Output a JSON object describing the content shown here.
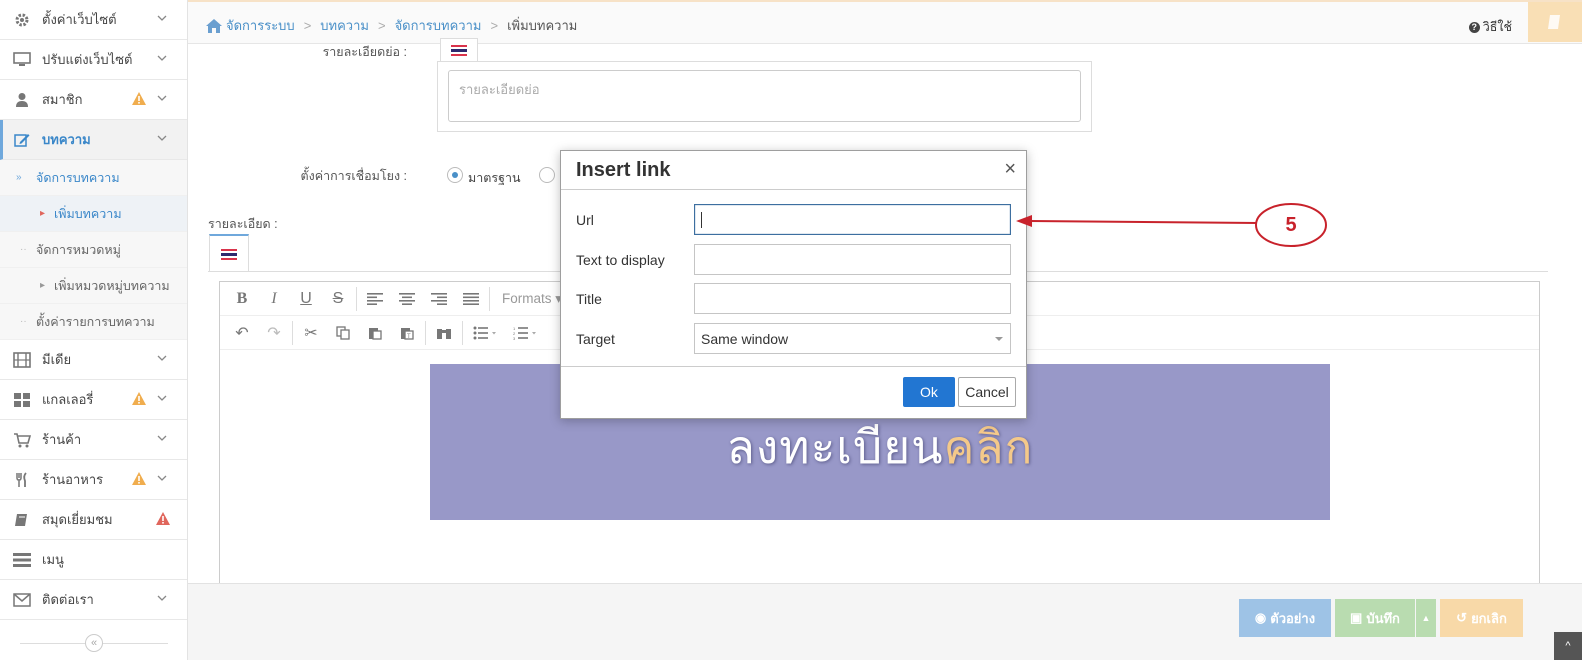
{
  "sidebar": {
    "items": [
      {
        "label": "ตั้งค่าเว็บไซต์",
        "icon": "gear-icon"
      },
      {
        "label": "ปรับแต่งเว็บไซต์",
        "icon": "monitor-icon"
      },
      {
        "label": "สมาชิก",
        "icon": "user-icon"
      },
      {
        "label": "บทความ",
        "icon": "edit-icon"
      },
      {
        "label": "มีเดีย",
        "icon": "film-icon"
      },
      {
        "label": "แกลเลอรี่",
        "icon": "grid-icon"
      },
      {
        "label": "ร้านค้า",
        "icon": "cart-icon"
      },
      {
        "label": "ร้านอาหาร",
        "icon": "utensils-icon"
      },
      {
        "label": "สมุดเยี่ยมชม",
        "icon": "book-icon"
      },
      {
        "label": "เมนู",
        "icon": "menu-icon"
      },
      {
        "label": "ติดต่อเรา",
        "icon": "envelope-icon"
      }
    ],
    "sub": {
      "manage_articles": "จัดการบทความ",
      "add_article": "เพิ่มบทความ",
      "manage_categories": "จัดการหมวดหมู่",
      "add_category": "เพิ่มหมวดหมู่บทความ",
      "article_settings": "ตั้งค่ารายการบทความ"
    },
    "collapse_glyph": "«"
  },
  "breadcrumb": {
    "items": [
      "จัดการระบบ",
      "บทความ",
      "จัดการบทความ",
      "เพิ่มบทความ"
    ],
    "separator": ">"
  },
  "header": {
    "help_label": "วิธีใช้"
  },
  "form": {
    "summary_label": "รายละเอียดย่อ :",
    "summary_placeholder": "รายละเอียดย่อ",
    "link_setting_label": "ตั้งค่าการเชื่อมโยง :",
    "link_option_standard": "มาตรฐาน",
    "detail_label": "รายละเอียด :"
  },
  "editor": {
    "formats_label": "Formats",
    "banner_text_main": "ลงทะเบียน",
    "banner_text_accent": "คลิก"
  },
  "dialog": {
    "title": "Insert link",
    "close_glyph": "×",
    "url_label": "Url",
    "url_value": "",
    "text_label": "Text to display",
    "text_value": "",
    "title_label": "Title",
    "title_value": "",
    "target_label": "Target",
    "target_value": "Same window",
    "ok_label": "Ok",
    "cancel_label": "Cancel"
  },
  "annotation": {
    "step_number": "5"
  },
  "bottombar": {
    "preview_label": "ตัวอย่าง",
    "save_label": "บันทึก",
    "cancel_label": "ยกเลิก",
    "to_top_glyph": "^"
  },
  "colors": {
    "primary": "#2276d2",
    "link": "#4a90c8",
    "warning": "#f0ad4e",
    "danger": "#e0665c",
    "annotation": "#c8222b",
    "banner": "#9898c8"
  }
}
